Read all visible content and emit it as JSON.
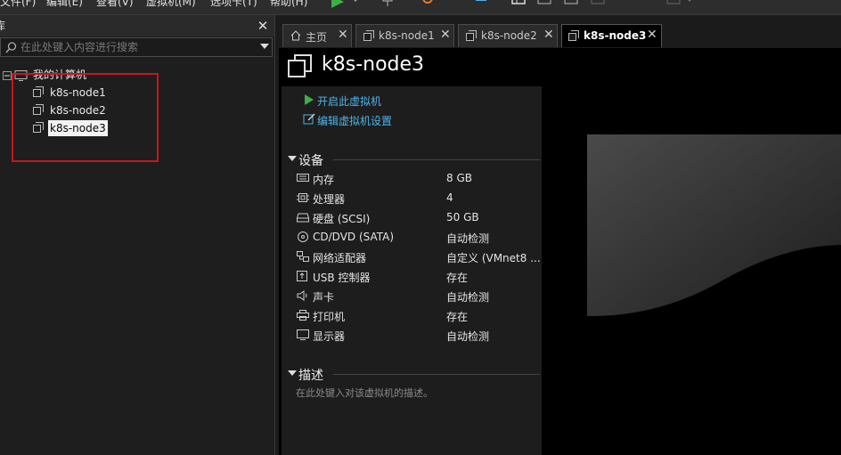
{
  "menubar": {
    "items": [
      "文件(F)",
      "编辑(E)",
      "查看(V)",
      "虚拟机(M)",
      "选项卡(T)",
      "帮助(H)"
    ]
  },
  "library": {
    "title": "库",
    "search_placeholder": "在此处键入内容进行搜索",
    "root_label": "我的计算机",
    "vms": [
      "k8s-node1",
      "k8s-node2",
      "k8s-node3"
    ],
    "selected_vm": "k8s-node3"
  },
  "tabs": [
    {
      "label": "主页",
      "icon": "home-icon",
      "active": false
    },
    {
      "label": "k8s-node1",
      "icon": "vm-icon",
      "active": false
    },
    {
      "label": "k8s-node2",
      "icon": "vm-icon",
      "active": false
    },
    {
      "label": "k8s-node3",
      "icon": "vm-icon",
      "active": true
    }
  ],
  "vm": {
    "title": "k8s-node3",
    "actions": {
      "power_on": "开启此虚拟机",
      "edit_settings": "编辑虚拟机设置"
    },
    "devices_header": "设备",
    "devices": [
      {
        "name": "内存",
        "value": "8 GB",
        "icon": "memory-icon"
      },
      {
        "name": "处理器",
        "value": "4",
        "icon": "cpu-icon"
      },
      {
        "name": "硬盘 (SCSI)",
        "value": "50 GB",
        "icon": "hard-disk-icon"
      },
      {
        "name": "CD/DVD (SATA)",
        "value": "自动检测",
        "icon": "cd-dvd-icon"
      },
      {
        "name": "网络适配器",
        "value": "自定义 (VMnet8 ...",
        "icon": "network-adapter-icon"
      },
      {
        "name": "USB 控制器",
        "value": "存在",
        "icon": "usb-icon"
      },
      {
        "name": "声卡",
        "value": "自动检测",
        "icon": "sound-card-icon"
      },
      {
        "name": "打印机",
        "value": "存在",
        "icon": "printer-icon"
      },
      {
        "name": "显示器",
        "value": "自动检测",
        "icon": "display-icon"
      }
    ],
    "description_header": "描述",
    "description_placeholder": "在此处键入对该虚拟机的描述。"
  },
  "colors": {
    "accent_link": "#4fb3e8",
    "play_green": "#3cb043",
    "highlight_red": "#c8161d"
  }
}
